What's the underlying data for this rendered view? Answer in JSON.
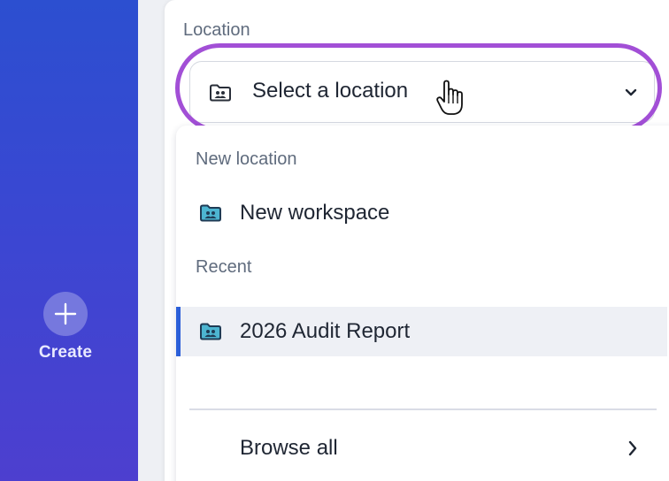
{
  "sidebar": {
    "create_label": "Create",
    "create_icon": "plus-icon"
  },
  "location_field": {
    "label": "Location",
    "placeholder": "Select a location",
    "icon": "shared-folder-icon",
    "expand_icon": "chevron-down-icon"
  },
  "dropdown": {
    "new_section_label": "New location",
    "new_items": [
      {
        "label": "New workspace",
        "icon": "shared-folder-icon"
      }
    ],
    "recent_section_label": "Recent",
    "recent_items": [
      {
        "label": "2026 Audit Report",
        "icon": "shared-folder-icon",
        "selected": true
      }
    ],
    "browse_all_label": "Browse all",
    "browse_all_icon": "chevron-right-icon"
  },
  "colors": {
    "highlight_ring": "#a24fd6",
    "selected_accent": "#2b5fd9",
    "folder_icon_fill": "#3aa7c4",
    "sidebar_gradient_top": "#2c4fd0",
    "sidebar_gradient_bottom": "#4d3fcf"
  }
}
